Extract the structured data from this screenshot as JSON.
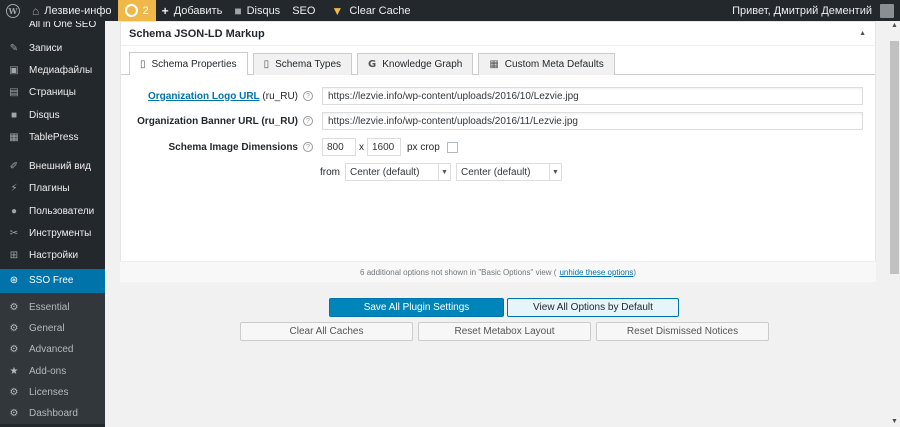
{
  "adminbar": {
    "site_name": "Лезвие-инфо",
    "updates_count": "2",
    "add_new": "Добавить",
    "disqus": "Disqus",
    "seo": "SEO",
    "clear_cache": "Clear Cache",
    "greeting": "Привет, Дмитрий Дементий"
  },
  "sidebar": {
    "cut_item": "All in One SEO",
    "items": [
      {
        "label": "Записи",
        "icon": "pin-icon"
      },
      {
        "label": "Медиафайлы",
        "icon": "media-icon"
      },
      {
        "label": "Страницы",
        "icon": "pages-icon"
      },
      {
        "label": "Disqus",
        "icon": "comment-icon"
      },
      {
        "label": "TablePress",
        "icon": "table-icon"
      }
    ],
    "items2": [
      {
        "label": "Внешний вид",
        "icon": "brush-icon"
      },
      {
        "label": "Плагины",
        "icon": "plugin-icon"
      },
      {
        "label": "Пользователи",
        "icon": "users-icon"
      },
      {
        "label": "Инструменты",
        "icon": "tools-icon"
      },
      {
        "label": "Настройки",
        "icon": "settings-icon"
      }
    ],
    "current": "SSO Free",
    "submenu": [
      {
        "label": "Essential",
        "icon": "gear-icon"
      },
      {
        "label": "General",
        "icon": "gear-icon"
      },
      {
        "label": "Advanced",
        "icon": "gear-icon"
      },
      {
        "label": "Add-ons",
        "icon": "star-icon"
      },
      {
        "label": "Licenses",
        "icon": "gear-icon"
      },
      {
        "label": "Dashboard",
        "icon": "gear-icon"
      }
    ]
  },
  "metabox": {
    "title": "Schema JSON-LD Markup",
    "tabs": [
      {
        "label": "Schema Properties"
      },
      {
        "label": "Schema Types"
      },
      {
        "label": "Knowledge Graph"
      },
      {
        "label": "Custom Meta Defaults"
      }
    ],
    "fields": {
      "logo_label": "Organization Logo URL",
      "logo_locale": " (ru_RU)",
      "logo_value": "https://lezvie.info/wp-content/uploads/2016/10/Lezvie.jpg",
      "banner_label": "Organization Banner URL (ru_RU)",
      "banner_value": "https://lezvie.info/wp-content/uploads/2016/11/Lezvie.jpg",
      "dimensions_label": "Schema Image Dimensions",
      "width": "800",
      "x": "x",
      "height": "1600",
      "crop_label": "px crop",
      "from_label": "from",
      "crop_x": "Center (default)",
      "crop_y": "Center (default)"
    },
    "note_prefix": "6 additional options not shown in \"Basic Options\" view (",
    "note_link": "unhide these options",
    "note_suffix": ")"
  },
  "buttons": {
    "save_all": "Save All Plugin Settings",
    "view_all": "View All Options by Default",
    "clear_caches": "Clear All Caches",
    "reset_metabox": "Reset Metabox Layout",
    "reset_notices": "Reset Dismissed Notices"
  }
}
